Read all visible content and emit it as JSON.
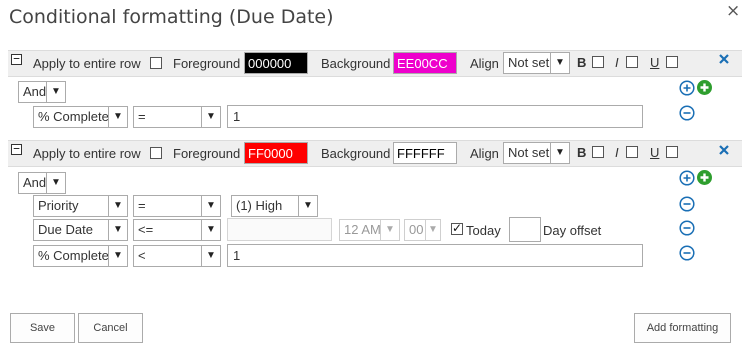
{
  "dialog": {
    "title": "Conditional formatting (Due Date)",
    "close_glyph": "×"
  },
  "rules": [
    {
      "apply_entire_row_label": "Apply to entire row",
      "foreground_label": "Foreground",
      "foreground_value": "000000",
      "foreground_color": "#000000",
      "foreground_text_color": "#ffffff",
      "background_label": "Background",
      "background_value": "EE00CC",
      "background_color": "#EE00CC",
      "background_text_color": "#ffffff",
      "align_label": "Align",
      "align_value": "Not set",
      "bold_label": "B",
      "italic_label": "I",
      "underline_label": "U",
      "logic": "And",
      "conditions": [
        {
          "field": "% Complete",
          "operator": "=",
          "value": "1"
        }
      ]
    },
    {
      "apply_entire_row_label": "Apply to entire row",
      "foreground_label": "Foreground",
      "foreground_value": "FF0000",
      "foreground_color": "#FF0000",
      "foreground_text_color": "#ffffff",
      "background_label": "Background",
      "background_value": "FFFFFF",
      "background_color": "#FFFFFF",
      "background_text_color": "#000000",
      "align_label": "Align",
      "align_value": "Not set",
      "bold_label": "B",
      "italic_label": "I",
      "underline_label": "U",
      "logic": "And",
      "conditions": [
        {
          "field": "Priority",
          "operator": "=",
          "value": "(1) High"
        },
        {
          "field": "Due Date",
          "operator": "<=",
          "value": "",
          "time_hour": "12 AM",
          "time_minute": "00",
          "today_checked": true,
          "today_label": "Today",
          "day_offset_value": "",
          "day_offset_label": "Day offset"
        },
        {
          "field": "% Complete",
          "operator": "<",
          "value": "1"
        }
      ]
    }
  ],
  "footer": {
    "save_label": "Save",
    "cancel_label": "Cancel",
    "add_formatting_label": "Add formatting"
  },
  "colors": {
    "add_blue": "#1a6fb5",
    "add_green": "#2e9e2e",
    "remove_blue": "#1a6fb5",
    "delete_x": "#1a6fb5"
  }
}
